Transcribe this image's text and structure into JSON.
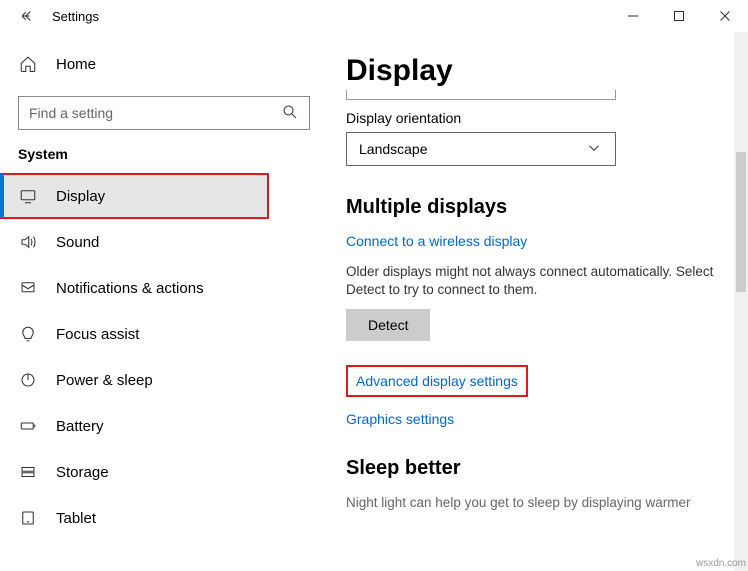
{
  "window": {
    "title": "Settings"
  },
  "sidebar": {
    "home_label": "Home",
    "search_placeholder": "Find a setting",
    "section_title": "System",
    "items": [
      {
        "label": "Display"
      },
      {
        "label": "Sound"
      },
      {
        "label": "Notifications & actions"
      },
      {
        "label": "Focus assist"
      },
      {
        "label": "Power & sleep"
      },
      {
        "label": "Battery"
      },
      {
        "label": "Storage"
      },
      {
        "label": "Tablet"
      }
    ]
  },
  "main": {
    "title": "Display",
    "orientation_label": "Display orientation",
    "orientation_value": "Landscape",
    "multi_heading": "Multiple displays",
    "wireless_link": "Connect to a wireless display",
    "detect_para": "Older displays might not always connect automatically. Select Detect to try to connect to them.",
    "detect_btn": "Detect",
    "advanced_link": "Advanced display settings",
    "graphics_link": "Graphics settings",
    "sleep_heading": "Sleep better",
    "sleep_para": "Night light can help you get to sleep by displaying warmer"
  },
  "watermark": "wsxdn.com"
}
